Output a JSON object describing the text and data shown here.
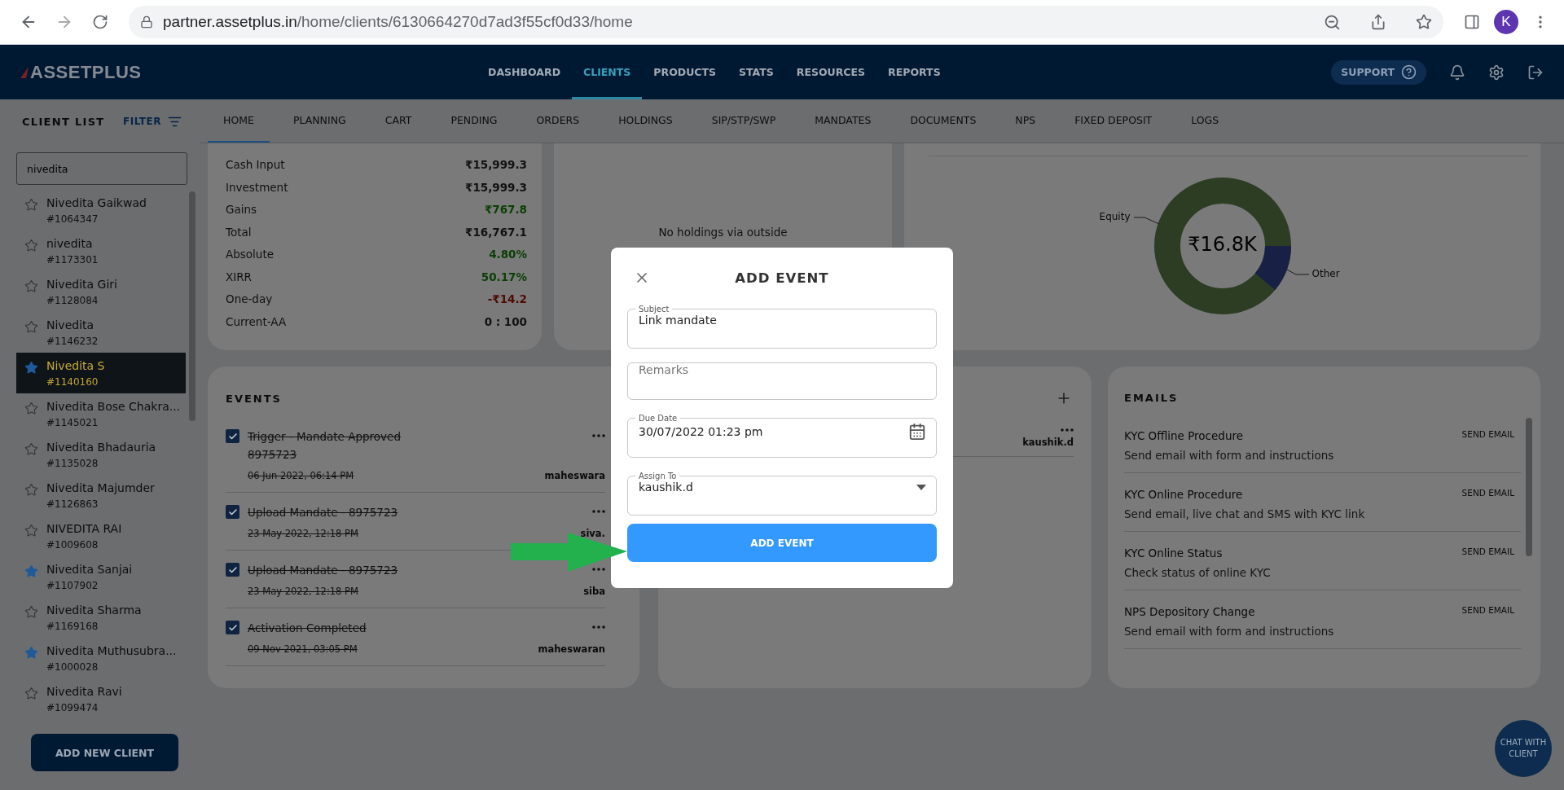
{
  "browser": {
    "url_host": "partner.assetplus.in",
    "url_path": "/home/clients/6130664270d7ad3f55cf0d33/home",
    "avatar": "K"
  },
  "header": {
    "logo": "ASSETPLUS",
    "nav": [
      {
        "label": "DASHBOARD",
        "selected": false
      },
      {
        "label": "CLIENTS",
        "selected": true
      },
      {
        "label": "PRODUCTS",
        "selected": false
      },
      {
        "label": "STATS",
        "selected": false
      },
      {
        "label": "RESOURCES",
        "selected": false
      },
      {
        "label": "REPORTS",
        "selected": false
      }
    ],
    "support": "SUPPORT"
  },
  "sidebar": {
    "title": "CLIENT LIST",
    "filter": "FILTER",
    "search": {
      "value": "nivedita"
    },
    "clients": [
      {
        "name": "Nivedita Gaikwad",
        "id": "#1064347",
        "starred": false,
        "selected": false
      },
      {
        "name": "nivedita",
        "id": "#1173301",
        "starred": false,
        "selected": false
      },
      {
        "name": "Nivedita Giri",
        "id": "#1128084",
        "starred": false,
        "selected": false
      },
      {
        "name": "Nivedita",
        "id": "#1146232",
        "starred": false,
        "selected": false
      },
      {
        "name": "Nivedita S",
        "id": "#1140160",
        "starred": true,
        "selected": true
      },
      {
        "name": "Nivedita Bose Chakra...",
        "id": "#1145021",
        "starred": false,
        "selected": false
      },
      {
        "name": "Nivedita Bhadauria",
        "id": "#1135028",
        "starred": false,
        "selected": false
      },
      {
        "name": "Nivedita Majumder",
        "id": "#1126863",
        "starred": false,
        "selected": false
      },
      {
        "name": "NIVEDITA RAI",
        "id": "#1009608",
        "starred": false,
        "selected": false
      },
      {
        "name": "Nivedita Sanjai",
        "id": "#1107902",
        "starred": true,
        "selected": false
      },
      {
        "name": "Nivedita Sharma",
        "id": "#1169168",
        "starred": false,
        "selected": false
      },
      {
        "name": "Nivedita Muthusubra...",
        "id": "#1000028",
        "starred": true,
        "selected": false
      },
      {
        "name": "Nivedita Ravi",
        "id": "#1099474",
        "starred": false,
        "selected": false
      }
    ],
    "add_button": "ADD NEW CLIENT"
  },
  "tabs": [
    {
      "label": "HOME",
      "selected": true
    },
    {
      "label": "PLANNING",
      "selected": false
    },
    {
      "label": "CART",
      "selected": false
    },
    {
      "label": "PENDING",
      "selected": false
    },
    {
      "label": "ORDERS",
      "selected": false
    },
    {
      "label": "HOLDINGS",
      "selected": false
    },
    {
      "label": "SIP/STP/SWP",
      "selected": false
    },
    {
      "label": "MANDATES",
      "selected": false
    },
    {
      "label": "DOCUMENTS",
      "selected": false
    },
    {
      "label": "NPS",
      "selected": false
    },
    {
      "label": "FIXED DEPOSIT",
      "selected": false
    },
    {
      "label": "LOGS",
      "selected": false
    }
  ],
  "summary": {
    "rows": [
      {
        "label": "Cash Input",
        "value": "₹15,999.3",
        "color": "#111111"
      },
      {
        "label": "Investment",
        "value": "₹15,999.3",
        "color": "#111111"
      },
      {
        "label": "Gains",
        "value": "₹767.8",
        "color": "#0b3f04"
      },
      {
        "label": "Total",
        "value": "₹16,767.1",
        "color": "#111111"
      },
      {
        "label": "Absolute",
        "value": "4.80%",
        "color": "#0b3f04"
      },
      {
        "label": "XIRR",
        "value": "50.17%",
        "color": "#0b3f04"
      },
      {
        "label": "One-day",
        "value": "-₹14.2",
        "color": "#4f0a02"
      },
      {
        "label": "Current-AA",
        "value": "0 : 100",
        "color": "#111111"
      }
    ]
  },
  "outside_holdings": {
    "message": "No holdings via outside"
  },
  "allocation": {
    "total": "₹16.8K",
    "left_label": "Equity",
    "right_label": "Other"
  },
  "events": {
    "title": "EVENTS",
    "items": [
      {
        "title": "Trigger - Mandate Approved\n8975723",
        "date": "06 Jun 2022, 06:14 PM",
        "author": "maheswara",
        "done": true
      },
      {
        "title": "Upload Mandate - 8975723",
        "date": "23 May 2022, 12:18 PM",
        "author": "siva.",
        "done": true
      },
      {
        "title": "Upload Mandate - 8975723",
        "date": "23 May 2022, 12:18 PM",
        "author": "siba",
        "done": true
      },
      {
        "title": "Activation Completed",
        "date": "09 Nov 2021, 03:05 PM",
        "author": "maheswaran",
        "done": true
      }
    ]
  },
  "tasks": {
    "items": [
      {
        "author": "kaushik.d"
      }
    ]
  },
  "emails": {
    "title": "EMAILS",
    "items": [
      {
        "title": "KYC Offline Procedure",
        "description": "Send email with form and instructions",
        "action": "SEND EMAIL"
      },
      {
        "title": "KYC Online Procedure",
        "description": "Send email, live chat and SMS with KYC link",
        "action": "SEND EMAIL"
      },
      {
        "title": "KYC Online Status",
        "description": "Check status of online KYC",
        "action": "SEND EMAIL"
      },
      {
        "title": "NPS Depository Change",
        "description": "Send email with form and instructions",
        "action": "SEND EMAIL"
      }
    ]
  },
  "modal": {
    "title": "ADD EVENT",
    "fields": [
      {
        "kind": "text",
        "label": "Subject",
        "value": "Link mandate"
      },
      {
        "kind": "text",
        "placeholder": "Remarks"
      },
      {
        "kind": "date",
        "label": "Due Date",
        "value": "30/07/2022 01:23 pm"
      },
      {
        "kind": "select",
        "label": "Assign To",
        "value": "kaushik.d"
      }
    ],
    "submit": "ADD EVENT"
  },
  "chat_button": "CHAT WITH\nCLIENT"
}
